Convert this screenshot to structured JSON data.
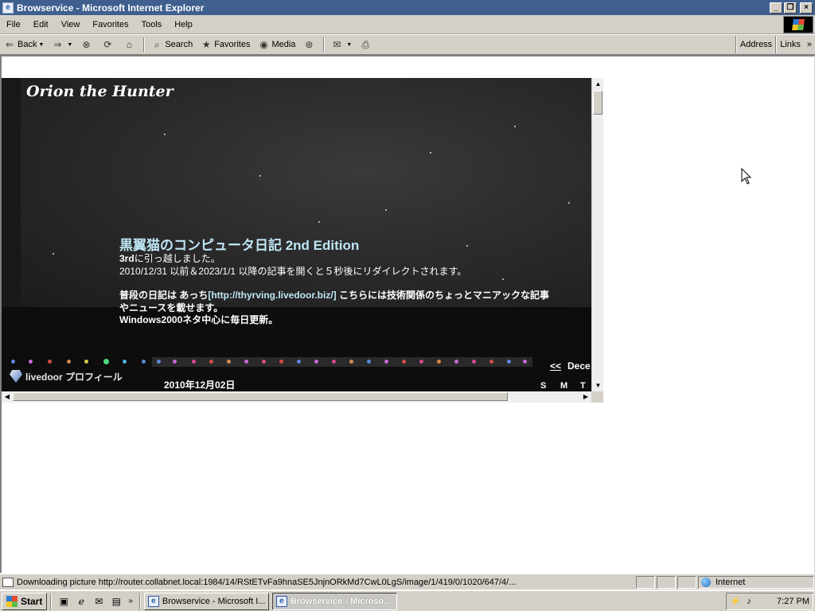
{
  "window": {
    "title": "Browservice - Microsoft Internet Explorer",
    "app_icon_glyph": "e",
    "buttons": {
      "minimize": "_",
      "restore": "❐",
      "close": "×"
    }
  },
  "menubar": {
    "items": [
      "File",
      "Edit",
      "View",
      "Favorites",
      "Tools",
      "Help"
    ]
  },
  "toolbar": {
    "back_label": "Back",
    "search_label": "Search",
    "favorites_label": "Favorites",
    "media_label": "Media",
    "address_label": "Address",
    "links_label": "Links",
    "links_chevron": "»"
  },
  "page": {
    "blog_title": "Orion the Hunter",
    "headline": "黒翼猫のコンピュータ日記 2nd Edition",
    "line1_bold": "3rd",
    "line1_rest": "に引っ越しました。",
    "line2": "2010/12/31 以前＆2023/1/1 以降の記事を開くと５秒後にリダイレクトされます。",
    "line3_a": "普段の日記は あっち",
    "line3_link": "[http://thyrving.livedoor.biz/]",
    "line3_b": " こちらには技術関係のちょっとマニアックな記事",
    "line4": "やニュースを載せます。",
    "line5": "Windows2000ネタ中心に毎日更新。",
    "profile_label": "livedoor プロフィール",
    "post_date": "2010年12月02日",
    "calendar_prev": "<<",
    "calendar_month_partial": "Dece",
    "calendar_days": [
      "S",
      "M",
      "T"
    ]
  },
  "statusbar": {
    "text": "Downloading picture http://router.collabnet.local:1984/14/RStETvFa9hnaSE5JnjnORkMd7CwL0LgS/image/1/419/0/1020/647/4/...",
    "zone": "Internet"
  },
  "taskbar": {
    "start_label": "Start",
    "tasks": [
      {
        "label": "Browservice - Microsoft I...",
        "active": false
      },
      {
        "label": "Browservice - Microso...",
        "active": true
      }
    ],
    "quicklaunch_chevron": "»",
    "clock": "7:27 PM"
  },
  "colors": {
    "titlebar": "#3f5f8f",
    "chrome": "#d4d0c8",
    "headline": "#bfe6f5",
    "link": "#bfe6f5"
  },
  "icons": {
    "back": "back-arrow-icon",
    "forward": "forward-arrow-icon",
    "stop": "stop-icon",
    "refresh": "refresh-icon",
    "home": "home-icon",
    "search": "search-icon",
    "favorites": "favorites-icon",
    "media": "media-icon",
    "history": "history-icon",
    "mail": "mail-icon",
    "print": "print-icon"
  }
}
